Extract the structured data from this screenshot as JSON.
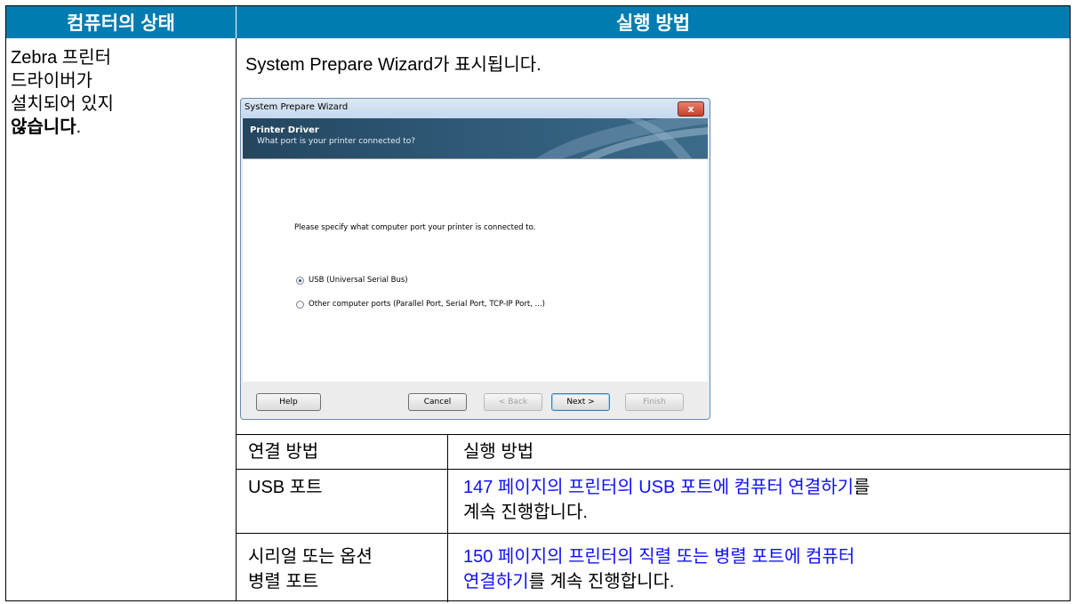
{
  "header": {
    "col1": "컴퓨터의 상태",
    "col2": "실행 방법"
  },
  "condition": {
    "line1": "Zebra 프린터",
    "line2": "드라이버가",
    "line3": "설치되어 있지",
    "bold": "않습니다",
    "period": "."
  },
  "intro": "System Prepare Wizard가 표시됩니다.",
  "wizard": {
    "title": "System Prepare Wizard",
    "close": "x",
    "banner_title": "Printer Driver",
    "banner_subtitle": "What port is your printer connected to?",
    "prompt": "Please specify what computer port your printer is connected to.",
    "options": [
      {
        "label": "USB (Universal Serial Bus)",
        "selected": true
      },
      {
        "label": "Other computer ports (Parallel Port, Serial Port, TCP-IP Port, ...)",
        "selected": false
      }
    ],
    "buttons": {
      "help": "Help",
      "cancel": "Cancel",
      "back": "< Back",
      "next": "Next >",
      "finish": "Finish"
    }
  },
  "inner_table": {
    "headers": [
      "연결 방법",
      "실행 방법"
    ],
    "rows": [
      {
        "method": "USB 포트",
        "link": "147 페이지의 프린터의 USB 포트에 컴퓨터 연결하기",
        "after": "를",
        "line2": "계속 진행합니다."
      },
      {
        "method1": "시리얼 또는 옵션",
        "method2": "병렬 포트",
        "link1": "150 페이지의 프린터의 직렬 또는 병렬 포트에 컴퓨터",
        "link2": "연결하기",
        "after": "를 계속 진행합니다."
      }
    ]
  },
  "colors": {
    "header_bg": "#007cb0",
    "link": "#1010ff"
  }
}
